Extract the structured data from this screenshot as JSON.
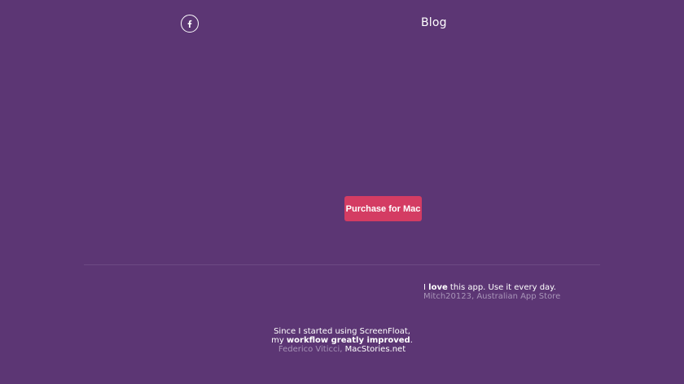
{
  "header": {
    "facebook_icon": "facebook-icon",
    "blog_label": "Blog"
  },
  "hero": {
    "purchase_label": "Purchase for Mac",
    "purchase_color": "#d43c63"
  },
  "colors": {
    "background": "#5c3674",
    "muted_text": "#a895b8"
  },
  "testimonials": [
    {
      "pre": "I ",
      "emphasis": "love",
      "post": " this app. Use it every day.",
      "author": "Mitch20123, Australian App Store"
    },
    {
      "line1": "Since I started using ScreenFloat,",
      "pre": "my ",
      "emphasis": "workflow greatly improved",
      "post": ".",
      "author": "Federico Viticci,",
      "source_link": "MacStories.net"
    }
  ]
}
